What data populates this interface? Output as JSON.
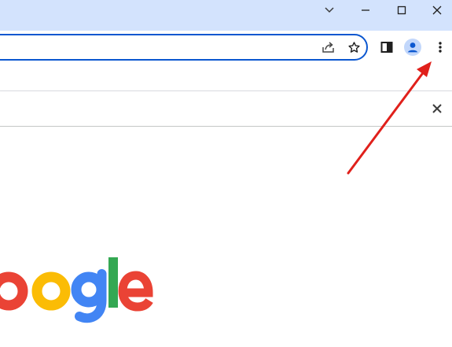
{
  "window_controls": {
    "tab_search_icon": "chevron-down-icon",
    "minimize_icon": "minimize-icon",
    "maximize_icon": "maximize-icon",
    "close_icon": "close-icon"
  },
  "toolbar": {
    "share_icon": "share-icon",
    "bookmark_icon": "star-icon",
    "side_panel_icon": "side-panel-icon",
    "profile_icon": "profile-avatar-icon",
    "menu_icon": "kebab-menu-icon"
  },
  "infobar": {
    "close_icon": "close-icon"
  },
  "logo": {
    "text": "oogle",
    "colors": [
      "#ea4335",
      "#fbbc05",
      "#4285f4",
      "#34a853",
      "#ea4335"
    ]
  },
  "annotation": {
    "arrow_color": "#e0201b",
    "points_to": "kebab-menu-icon"
  }
}
